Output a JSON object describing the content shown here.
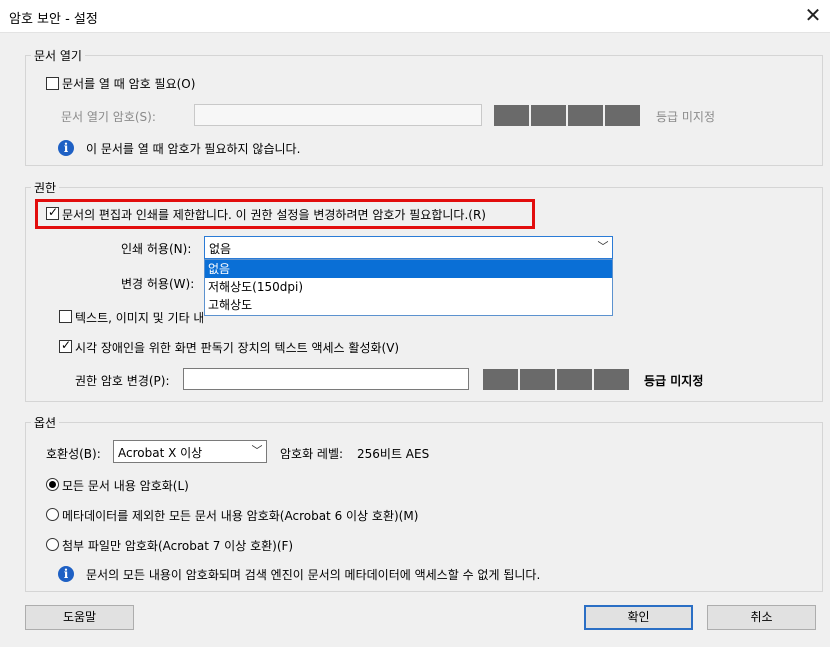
{
  "window": {
    "title": "암호 보안 - 설정",
    "close_label": "✕"
  },
  "open_section": {
    "legend": "문서 열기",
    "require_password_label": "문서를 열 때 암호 필요(O)",
    "require_password_checked": false,
    "password_label": "문서 열기 암호(S):",
    "password_value": "",
    "strength_label": "등급 미지정",
    "info_text": "이 문서를 열 때 암호가 필요하지 않습니다."
  },
  "permissions": {
    "legend": "권한",
    "restrict_label": "문서의 편집과 인쇄를 제한합니다. 이 권한 설정을 변경하려면 암호가 필요합니다.(R)",
    "restrict_checked": true,
    "print_label": "인쇄 허용(N):",
    "print_value": "없음",
    "print_options": [
      "없음",
      "저해상도(150dpi)",
      "고해상도"
    ],
    "change_label": "변경 허용(W):",
    "copy_label": "텍스트, 이미지 및 기타 내용 복사 활성화(E)",
    "copy_checked": false,
    "screenreader_label": "시각 장애인을 위한 화면 판독기 장치의 텍스트 액세스 활성화(V)",
    "screenreader_checked": true,
    "perm_password_label": "권한 암호 변경(P):",
    "perm_password_value": "",
    "strength_label": "등급 미지정"
  },
  "options": {
    "legend": "옵션",
    "compat_label": "호환성(B):",
    "compat_value": "Acrobat X 이상",
    "encryption_level_label": "암호화 레벨:",
    "encryption_level_value": "256비트 AES",
    "radio_all": "모든 문서 내용 암호화(L)",
    "radio_except_meta": "메타데이터를 제외한 모든 문서 내용 암호화(Acrobat 6 이상 호환)(M)",
    "radio_attachments": "첨부 파일만 암호화(Acrobat 7 이상 호환)(F)",
    "selected_radio": "radio_all",
    "info_text": "문서의 모든 내용이 암호화되며 검색 엔진이 문서의 메타데이터에 액세스할 수 없게 됩니다."
  },
  "buttons": {
    "help": "도움말",
    "ok": "확인",
    "cancel": "취소"
  },
  "colors": {
    "highlight_border": "#e20d0d",
    "selection": "#0a6fd6",
    "info_icon": "#1e60c4"
  }
}
